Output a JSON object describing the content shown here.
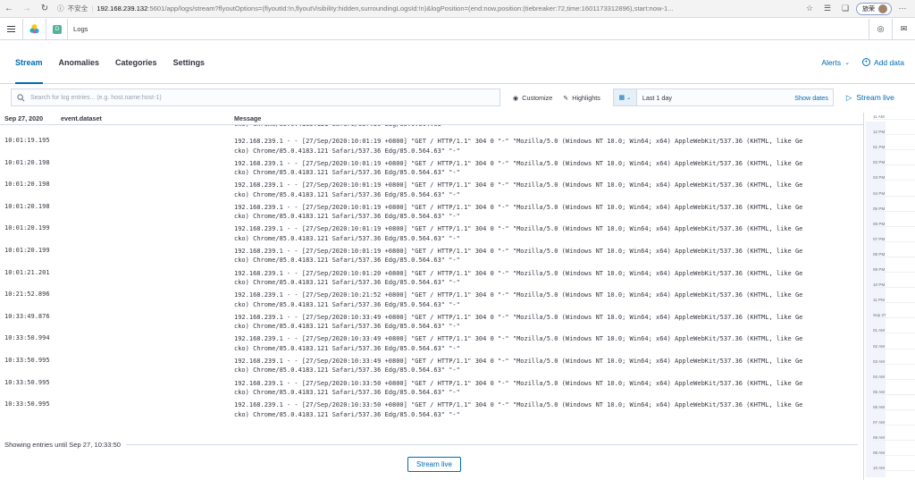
{
  "browser": {
    "security_warning": "不安全",
    "url_host": "192.168.239.132",
    "url_path": ":5601/app/logs/stream?flyoutOptions=(flyoutId:!n,flyoutVisibility:hidden,surroundingLogsId:!n)&logPosition=(end:now,position:(tiebreaker:72,time:1601173312896),start:now-1...",
    "profile_name": "旅荣"
  },
  "header": {
    "space_initial": "D",
    "app_name": "Logs"
  },
  "tabs": [
    {
      "label": "Stream",
      "active": true
    },
    {
      "label": "Anomalies",
      "active": false
    },
    {
      "label": "Categories",
      "active": false
    },
    {
      "label": "Settings",
      "active": false
    }
  ],
  "tabs_right": {
    "alerts": "Alerts",
    "add_data": "Add data"
  },
  "toolbar": {
    "search_placeholder": "Search for log entries... (e.g. host.name:host-1)",
    "customize": "Customize",
    "highlights": "Highlights",
    "date_range": "Last 1 day",
    "show_dates": "Show dates",
    "stream_live": "Stream live"
  },
  "table": {
    "col_date": "Sep 27, 2020",
    "col_dataset": "event.dataset",
    "col_message": "Message",
    "rows": [
      {
        "ts": "10:01:19.195",
        "line1": "192.168.239.1 - - [27/Sep/2020:10:01:19 +0800] \"GET / HTTP/1.1\" 304 0 \"-\" \"Mozilla/5.0 (Windows NT 10.0; Win64; x64) AppleWebKit/537.36 (KHTML, like Ge",
        "line2": "cko) Chrome/85.0.4183.121 Safari/537.36 Edg/85.0.564.63\" \"-\""
      },
      {
        "ts": "10:01:20.198",
        "line1": "192.168.239.1 - - [27/Sep/2020:10:01:19 +0800] \"GET / HTTP/1.1\" 304 0 \"-\" \"Mozilla/5.0 (Windows NT 10.0; Win64; x64) AppleWebKit/537.36 (KHTML, like Ge",
        "line2": "cko) Chrome/85.0.4183.121 Safari/537.36 Edg/85.0.564.63\" \"-\""
      },
      {
        "ts": "10:01:20.198",
        "line1": "192.168.239.1 - - [27/Sep/2020:10:01:19 +0800] \"GET / HTTP/1.1\" 304 0 \"-\" \"Mozilla/5.0 (Windows NT 10.0; Win64; x64) AppleWebKit/537.36 (KHTML, like Ge",
        "line2": "cko) Chrome/85.0.4183.121 Safari/537.36 Edg/85.0.564.63\" \"-\""
      },
      {
        "ts": "10:01:20.198",
        "line1": "192.168.239.1 - - [27/Sep/2020:10:01:19 +0800] \"GET / HTTP/1.1\" 304 0 \"-\" \"Mozilla/5.0 (Windows NT 10.0; Win64; x64) AppleWebKit/537.36 (KHTML, like Ge",
        "line2": "cko) Chrome/85.0.4183.121 Safari/537.36 Edg/85.0.564.63\" \"-\""
      },
      {
        "ts": "10:01:20.199",
        "line1": "192.168.239.1 - - [27/Sep/2020:10:01:19 +0800] \"GET / HTTP/1.1\" 304 0 \"-\" \"Mozilla/5.0 (Windows NT 10.0; Win64; x64) AppleWebKit/537.36 (KHTML, like Ge",
        "line2": "cko) Chrome/85.0.4183.121 Safari/537.36 Edg/85.0.564.63\" \"-\""
      },
      {
        "ts": "10:01:20.199",
        "line1": "192.168.239.1 - - [27/Sep/2020:10:01:19 +0800] \"GET / HTTP/1.1\" 304 0 \"-\" \"Mozilla/5.0 (Windows NT 10.0; Win64; x64) AppleWebKit/537.36 (KHTML, like Ge",
        "line2": "cko) Chrome/85.0.4183.121 Safari/537.36 Edg/85.0.564.63\" \"-\""
      },
      {
        "ts": "10:01:21.201",
        "line1": "192.168.239.1 - - [27/Sep/2020:10:01:20 +0800] \"GET / HTTP/1.1\" 304 0 \"-\" \"Mozilla/5.0 (Windows NT 10.0; Win64; x64) AppleWebKit/537.36 (KHTML, like Ge",
        "line2": "cko) Chrome/85.0.4183.121 Safari/537.36 Edg/85.0.564.63\" \"-\""
      },
      {
        "ts": "10:21:52.896",
        "line1": "192.168.239.1 - - [27/Sep/2020:10:21:52 +0800] \"GET / HTTP/1.1\" 304 0 \"-\" \"Mozilla/5.0 (Windows NT 10.0; Win64; x64) AppleWebKit/537.36 (KHTML, like Ge",
        "line2": "cko) Chrome/85.0.4183.121 Safari/537.36 Edg/85.0.564.63\" \"-\""
      },
      {
        "ts": "10:33:49.876",
        "line1": "192.168.239.1 - - [27/Sep/2020:10:33:49 +0800] \"GET / HTTP/1.1\" 304 0 \"-\" \"Mozilla/5.0 (Windows NT 10.0; Win64; x64) AppleWebKit/537.36 (KHTML, like Ge",
        "line2": "cko) Chrome/85.0.4183.121 Safari/537.36 Edg/85.0.564.63\" \"-\""
      },
      {
        "ts": "10:33:50.994",
        "line1": "192.168.239.1 - - [27/Sep/2020:10:33:49 +0800] \"GET / HTTP/1.1\" 304 0 \"-\" \"Mozilla/5.0 (Windows NT 10.0; Win64; x64) AppleWebKit/537.36 (KHTML, like Ge",
        "line2": "cko) Chrome/85.0.4183.121 Safari/537.36 Edg/85.0.564.63\" \"-\""
      },
      {
        "ts": "10:33:50.995",
        "line1": "192.168.239.1 - - [27/Sep/2020:10:33:49 +0800] \"GET / HTTP/1.1\" 304 0 \"-\" \"Mozilla/5.0 (Windows NT 10.0; Win64; x64) AppleWebKit/537.36 (KHTML, like Ge",
        "line2": "cko) Chrome/85.0.4183.121 Safari/537.36 Edg/85.0.564.63\" \"-\""
      },
      {
        "ts": "10:33:50.995",
        "line1": "192.168.239.1 - - [27/Sep/2020:10:33:50 +0800] \"GET / HTTP/1.1\" 304 0 \"-\" \"Mozilla/5.0 (Windows NT 10.0; Win64; x64) AppleWebKit/537.36 (KHTML, like Ge",
        "line2": "cko) Chrome/85.0.4183.121 Safari/537.36 Edg/85.0.564.63\" \"-\""
      },
      {
        "ts": "10:33:50.995",
        "line1": "192.168.239.1 - - [27/Sep/2020:10:33:50 +0800] \"GET / HTTP/1.1\" 304 0 \"-\" \"Mozilla/5.0 (Windows NT 10.0; Win64; x64) AppleWebKit/537.36 (KHTML, like Ge",
        "line2": "cko) Chrome/85.0.4183.121 Safari/537.36 Edg/85.0.564.63\" \"-\""
      }
    ]
  },
  "footer": {
    "showing_entries": "Showing entries until Sep 27, 10:33:50",
    "stream_live": "Stream live"
  },
  "minimap": {
    "ticks": [
      "11 AM",
      "12 PM",
      "01 PM",
      "02 PM",
      "03 PM",
      "04 PM",
      "05 PM",
      "06 PM",
      "07 PM",
      "08 PM",
      "09 PM",
      "10 PM",
      "11 PM",
      "Sep 27",
      "01 AM",
      "02 AM",
      "03 AM",
      "04 AM",
      "05 AM",
      "06 AM",
      "07 AM",
      "08 AM",
      "09 AM",
      "10 AM"
    ]
  },
  "colors": {
    "accent": "#006bb4",
    "border": "#d3dae6",
    "text": "#343741"
  }
}
